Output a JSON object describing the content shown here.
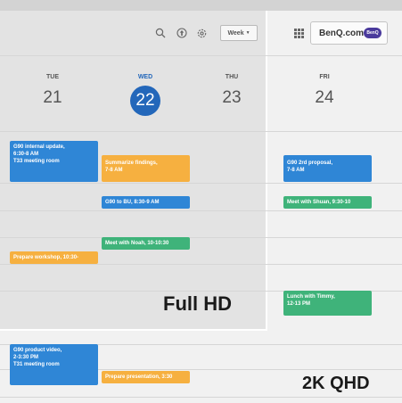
{
  "toolbar": {
    "view_select": "Week",
    "brand_label": "BenQ.com",
    "brand_logo_text": "BenQ"
  },
  "days": [
    {
      "name": "TUE",
      "number": "21"
    },
    {
      "name": "WED",
      "number": "22"
    },
    {
      "name": "THU",
      "number": "23"
    },
    {
      "name": "FRI",
      "number": "24"
    }
  ],
  "events": {
    "tue_g90_update": "G90 internal update,\n6:30-8 AM\nT33 meeting room",
    "tue_prepare_workshop": "Prepare workshop, 10:30-",
    "tue_g90_video": "G90 product video,\n2-3:30 PM\nT31 meeting room",
    "wed_summarize": "Summarize findings,\n7-8 AM",
    "wed_g90_bu": "G90 to BU, 8:30-9 AM",
    "wed_meet_noah": "Meet with Noah, 10-10:30",
    "wed_prepare_presentation": "Prepare presentation, 3:30",
    "fri_g90_proposal": "G90 2rd proposal,\n7-8 AM",
    "fri_meet_shuan": "Meet with Shuan, 9:30-10",
    "fri_lunch_timmy": "Lunch with Timmy,\n12-13 PM"
  },
  "labels": {
    "full_hd": "Full HD",
    "qhd": "2K QHD"
  },
  "colors": {
    "today": "#2367ba",
    "event_blue": "#2f86d6",
    "event_orange": "#f6b040",
    "event_green": "#3fb37a"
  },
  "icons": [
    "search-icon",
    "upload-icon",
    "gear-icon",
    "apps-grid-icon",
    "chevron-down-icon"
  ]
}
